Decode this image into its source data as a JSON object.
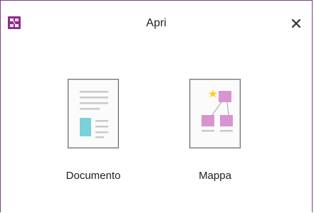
{
  "window": {
    "title": "Apri",
    "close_glyph": "✕",
    "accent_color": "#8e2d8f"
  },
  "options": [
    {
      "label": "Documento",
      "icon": "document-thumbnail-icon"
    },
    {
      "label": "Mappa",
      "icon": "map-thumbnail-icon"
    }
  ]
}
